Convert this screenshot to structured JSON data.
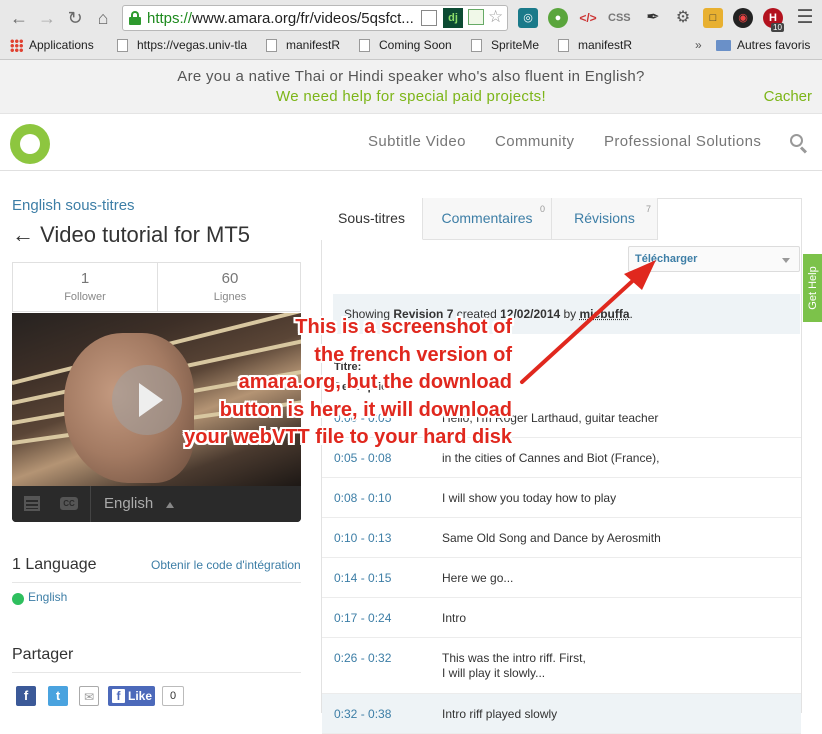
{
  "browser": {
    "url_scheme": "https://",
    "url_rest": "www.amara.org/fr/videos/5qsfct...",
    "bookmarks": [
      "Applications",
      "https://vegas.univ-tla",
      "manifestR",
      "Coming Soon",
      "SpriteMe",
      "manifestR"
    ],
    "overflow_label": "»",
    "other_bookmarks": "Autres favoris",
    "extensions": {
      "dj": "dj",
      "css": "CSS",
      "code": "</>",
      "badge": "10"
    }
  },
  "banner": {
    "line1": "Are you a native Thai or Hindi speaker who's also fluent in English?",
    "line2": "We need help for special paid projects!",
    "dismiss": "Cacher",
    "accent_color": "#7cb518"
  },
  "site_nav": {
    "items": [
      "Subtitle Video",
      "Community",
      "Professional Solutions"
    ],
    "brand_color": "#8dc63f"
  },
  "video": {
    "subtitle_language": "English sous-titres",
    "title": "← Video tutorial for MT5",
    "stats": [
      {
        "value": "1",
        "label": "Follower"
      },
      {
        "value": "60",
        "label": "Lignes"
      }
    ],
    "player_language": "English"
  },
  "languages": {
    "count_label": "1 Language",
    "embed_link": "Obtenir le code d'intégration",
    "items": [
      "English"
    ]
  },
  "share": {
    "title": "Partager",
    "like_label": "Like",
    "like_count": "0"
  },
  "tabs": [
    {
      "label": "Sous-titres",
      "badge": ""
    },
    {
      "label": "Commentaires",
      "badge": "0"
    },
    {
      "label": "Révisions",
      "badge": "7"
    }
  ],
  "download": {
    "label": "Télécharger"
  },
  "get_help": "Get Help",
  "revision": {
    "prefix": "Showing ",
    "revision": "Revision 7",
    "created": " created ",
    "date": "12/02/2014",
    "by": " by ",
    "user": "micbuffa",
    "suffix": "."
  },
  "meta": {
    "title_label": "Titre:",
    "description_label": "Description:"
  },
  "subtitles": [
    {
      "time": "0:00 - 0:05",
      "text": "Hello, I'm Roger Larthaud, guitar teacher"
    },
    {
      "time": "0:05 - 0:08",
      "text": "in the cities of Cannes and Biot (France),"
    },
    {
      "time": "0:08 - 0:10",
      "text": "I will show you today how to play"
    },
    {
      "time": "0:10 - 0:13",
      "text": "Same Old Song and Dance by Aerosmith"
    },
    {
      "time": "0:14 - 0:15",
      "text": "Here we go..."
    },
    {
      "time": "0:17 - 0:24",
      "text": "Intro"
    },
    {
      "time": "0:26 - 0:32",
      "text": "This was the intro riff. First,",
      "text2": "I will play it slowly..."
    },
    {
      "time": "0:32 - 0:38",
      "text": "Intro riff played slowly"
    }
  ],
  "annotation": {
    "lines": [
      "This is a screenshot of",
      "the french version of",
      "amara.org, but the download",
      "button is here, it will download",
      "your webVTT file to your hard disk"
    ],
    "color": "#e0281e"
  }
}
